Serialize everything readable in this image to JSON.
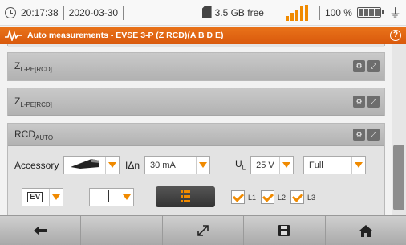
{
  "status": {
    "time": "20:17:38",
    "date": "2020-03-30",
    "storage": "3.5 GB free",
    "battery": "100 %",
    "signal_level": 1.0,
    "battery_level": 1.0
  },
  "title": {
    "text": "Auto measurements - EVSE 3-P (Z RCD)(A B D E)",
    "help": "?"
  },
  "panels": [
    {
      "name": "Z",
      "sub": "L-PE[RCD]"
    },
    {
      "name": "Z",
      "sub": "L-PE[RCD]"
    },
    {
      "name": "RCD",
      "sub": "AUTO"
    }
  ],
  "rcd": {
    "accessory_label": "Accessory",
    "idn_label": "IΔn",
    "idn_value": "30 mA",
    "ul_label": "U",
    "ul_sub": "L",
    "ul_value": "25 V",
    "mode_value": "Full",
    "ev_value": "EV",
    "checks": [
      {
        "label": "L1",
        "checked": true
      },
      {
        "label": "L2",
        "checked": true
      },
      {
        "label": "L3",
        "checked": true
      }
    ]
  },
  "nav": [
    "back-icon",
    "column-icon",
    "fullscreen-icon",
    "save-icon",
    "home-icon"
  ],
  "colors": {
    "accent": "#f08a00",
    "title_bar": "#e1650f"
  }
}
